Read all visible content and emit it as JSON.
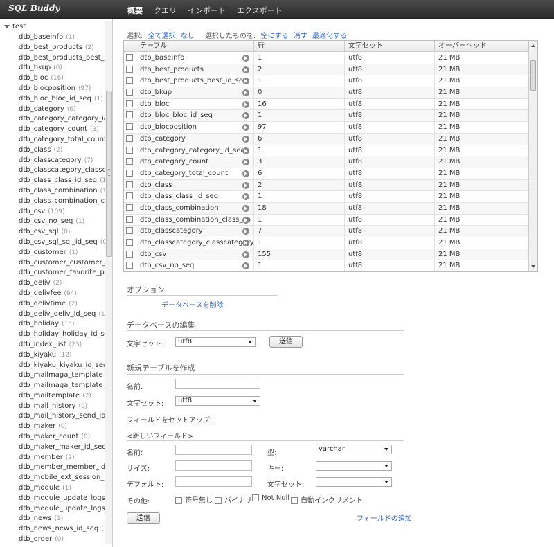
{
  "app": {
    "title": "SQL Buddy"
  },
  "nav": [
    "概要",
    "クエリ",
    "インポート",
    "エクスポート"
  ],
  "sidebar": {
    "database": "test",
    "tables": [
      {
        "name": "dtb_baseinfo",
        "count": "(1)"
      },
      {
        "name": "dtb_best_products",
        "count": "(2)"
      },
      {
        "name": "dtb_best_products_best_id_",
        "count": ""
      },
      {
        "name": "dtb_bkup",
        "count": "(0)"
      },
      {
        "name": "dtb_bloc",
        "count": "(16)"
      },
      {
        "name": "dtb_blocposition",
        "count": "(97)"
      },
      {
        "name": "dtb_bloc_bloc_id_seq",
        "count": "(1)"
      },
      {
        "name": "dtb_category",
        "count": "(6)"
      },
      {
        "name": "dtb_category_category_id_s",
        "count": ""
      },
      {
        "name": "dtb_category_count",
        "count": "(3)"
      },
      {
        "name": "dtb_category_total_count",
        "count": "(6"
      },
      {
        "name": "dtb_class",
        "count": "(2)"
      },
      {
        "name": "dtb_classcategory",
        "count": "(7)"
      },
      {
        "name": "dtb_classcategory_classcat",
        "count": ""
      },
      {
        "name": "dtb_class_class_id_seq",
        "count": "(1"
      },
      {
        "name": "dtb_class_combination",
        "count": "(18"
      },
      {
        "name": "dtb_class_combination_clas",
        "count": ""
      },
      {
        "name": "dtb_csv",
        "count": "(109)"
      },
      {
        "name": "dtb_csv_no_seq",
        "count": "(1)"
      },
      {
        "name": "dtb_csv_sql",
        "count": "(0)"
      },
      {
        "name": "dtb_csv_sql_sql_id_seq",
        "count": "(0"
      },
      {
        "name": "dtb_customer",
        "count": "(1)"
      },
      {
        "name": "dtb_customer_customer_id_",
        "count": ""
      },
      {
        "name": "dtb_customer_favorite_prod",
        "count": ""
      },
      {
        "name": "dtb_deliv",
        "count": "(2)"
      },
      {
        "name": "dtb_delivfee",
        "count": "(94)"
      },
      {
        "name": "dtb_delivtime",
        "count": "(2)"
      },
      {
        "name": "dtb_deliv_deliv_id_seq",
        "count": "(1)"
      },
      {
        "name": "dtb_holiday",
        "count": "(15)"
      },
      {
        "name": "dtb_holiday_holiday_id_seq",
        "count": ""
      },
      {
        "name": "dtb_index_list",
        "count": "(23)"
      },
      {
        "name": "dtb_kiyaku",
        "count": "(12)"
      },
      {
        "name": "dtb_kiyaku_kiyaku_id_seq",
        "count": "("
      },
      {
        "name": "dtb_mailmaga_template",
        "count": "(0)"
      },
      {
        "name": "dtb_mailmaga_template_te",
        "count": ""
      },
      {
        "name": "dtb_mailtemplate",
        "count": "(2)"
      },
      {
        "name": "dtb_mail_history",
        "count": "(0)"
      },
      {
        "name": "dtb_mail_history_send_id_s",
        "count": ""
      },
      {
        "name": "dtb_maker",
        "count": "(0)"
      },
      {
        "name": "dtb_maker_count",
        "count": "(0)"
      },
      {
        "name": "dtb_maker_maker_id_seq",
        "count": "("
      },
      {
        "name": "dtb_member",
        "count": "(2)"
      },
      {
        "name": "dtb_member_member_id_s",
        "count": ""
      },
      {
        "name": "dtb_mobile_ext_session_id",
        "count": ""
      },
      {
        "name": "dtb_module",
        "count": "(1)"
      },
      {
        "name": "dtb_module_update_logs",
        "count": "(0"
      },
      {
        "name": "dtb_module_update_logs_l",
        "count": ""
      },
      {
        "name": "dtb_news",
        "count": "(1)"
      },
      {
        "name": "dtb_news_news_id_seq",
        "count": "(1"
      },
      {
        "name": "dtb_order",
        "count": "(0)"
      }
    ]
  },
  "selection": {
    "label": "選択:",
    "all": "全て選択",
    "none": "なし",
    "with_selected": "選択したものを:",
    "empty": "空にする",
    "drop": "消す",
    "optimize": "最適化する"
  },
  "grid": {
    "columns": [
      "テーブル",
      "行",
      "文字セット",
      "オーバーヘッド"
    ],
    "rows": [
      [
        "dtb_baseinfo",
        "1",
        "utf8",
        "21 MB"
      ],
      [
        "dtb_best_products",
        "2",
        "utf8",
        "21 MB"
      ],
      [
        "dtb_best_products_best_id_seq",
        "1",
        "utf8",
        "21 MB"
      ],
      [
        "dtb_bkup",
        "0",
        "utf8",
        "21 MB"
      ],
      [
        "dtb_bloc",
        "16",
        "utf8",
        "21 MB"
      ],
      [
        "dtb_bloc_bloc_id_seq",
        "1",
        "utf8",
        "21 MB"
      ],
      [
        "dtb_blocposition",
        "97",
        "utf8",
        "21 MB"
      ],
      [
        "dtb_category",
        "6",
        "utf8",
        "21 MB"
      ],
      [
        "dtb_category_category_id_seq",
        "1",
        "utf8",
        "21 MB"
      ],
      [
        "dtb_category_count",
        "3",
        "utf8",
        "21 MB"
      ],
      [
        "dtb_category_total_count",
        "6",
        "utf8",
        "21 MB"
      ],
      [
        "dtb_class",
        "2",
        "utf8",
        "21 MB"
      ],
      [
        "dtb_class_class_id_seq",
        "1",
        "utf8",
        "21 MB"
      ],
      [
        "dtb_class_combination",
        "18",
        "utf8",
        "21 MB"
      ],
      [
        "dtb_class_combination_class_co",
        "1",
        "utf8",
        "21 MB"
      ],
      [
        "dtb_classcategory",
        "7",
        "utf8",
        "21 MB"
      ],
      [
        "dtb_classcategory_classcategory_",
        "1",
        "utf8",
        "21 MB"
      ],
      [
        "dtb_csv",
        "155",
        "utf8",
        "21 MB"
      ],
      [
        "dtb_csv_no_seq",
        "1",
        "utf8",
        "21 MB"
      ]
    ]
  },
  "options": {
    "title": "オプション",
    "delete_db": "データベースを削除"
  },
  "edit_db": {
    "title": "データベースの編集",
    "charset_label": "文字セット:",
    "charset_value": "utf8",
    "submit": "送信"
  },
  "new_table": {
    "title": "新規テーブルを作成",
    "name_label": "名前:",
    "charset_label": "文字セット:",
    "charset_value": "utf8",
    "setup_fields": "フィールドをセットアップ:",
    "new_field": "<新しいフィールド>",
    "field_name_label": "名前:",
    "type_label": "型:",
    "type_value": "varchar",
    "size_label": "サイズ:",
    "key_label": "キー:",
    "default_label": "デフォルト:",
    "field_charset_label": "文字セット:",
    "other_label": "その他:",
    "unsigned": "符号無し",
    "binary": "バイナリ",
    "not_null": "Not Null",
    "auto_increment": "自動インクリメント",
    "submit": "送信",
    "add_field": "フィールドの追加"
  }
}
